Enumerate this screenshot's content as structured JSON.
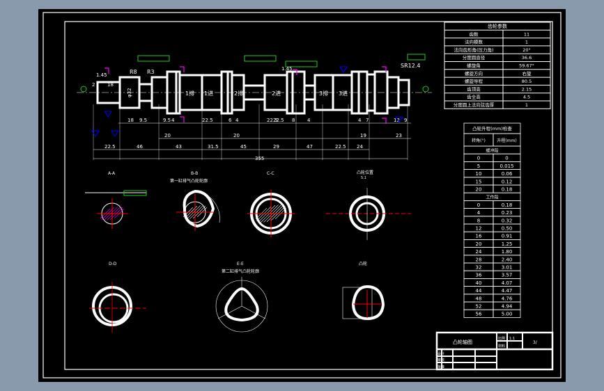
{
  "colors": {
    "background": "#8a9aad",
    "canvas": "#000000",
    "line": "#ffffff",
    "centerline": "#ff0000",
    "tolerance": "#22cc22",
    "section_mark": "#ff00ff",
    "roughness": "#0000ff"
  },
  "shaft": {
    "labels": {
      "r8": "R8",
      "r3": "R3",
      "chamfer1": "1.45",
      "chamfer2": "1.45",
      "dia": "φ32",
      "d18": "18",
      "d2": "2",
      "sr": "SR12.4"
    },
    "cams": [
      "1排",
      "1进",
      "2排",
      "2进",
      "3排",
      "3进"
    ],
    "dims_row1": [
      "18",
      "9.5",
      "9.5",
      "4",
      "22.5",
      "6",
      "4",
      "22.5",
      "8",
      "4",
      "22.5",
      "4",
      "7",
      "12",
      "9"
    ],
    "dims_row2": [
      "20",
      "20",
      "19",
      "23"
    ],
    "dims_row3": [
      "22.5",
      "46",
      "43",
      "31.5",
      "45",
      "29",
      "47",
      "22.5",
      "24"
    ],
    "total": "355"
  },
  "sections": [
    {
      "label": "A-A"
    },
    {
      "label": "B-B",
      "note": "第一缸排气凸轮轮廓"
    },
    {
      "label": "C-C"
    },
    {
      "label": "凸轮位置",
      "sub": "5.1"
    },
    {
      "label": "D-D"
    },
    {
      "label": "E-E",
      "note": "第二缸排气凸轮轮廓"
    },
    {
      "label": "凸轮"
    }
  ],
  "param_table": {
    "title": "齿轮参数",
    "rows": [
      [
        "齿数",
        "11"
      ],
      [
        "法向模数",
        "1"
      ],
      [
        "法向齿形角(压力角)",
        "20°"
      ],
      [
        "分度圆直径",
        "36.6"
      ],
      [
        "螺旋角",
        "59.67°"
      ],
      [
        "螺旋方向",
        "右旋"
      ],
      [
        "螺旋导程",
        "80.5"
      ],
      [
        "齿顶高",
        "2.15"
      ],
      [
        "齿全高",
        "4.5"
      ],
      [
        "分度圆上法向弦齿厚",
        "1"
      ]
    ]
  },
  "lift_table": {
    "title": "凸轮升程(mm)检查",
    "headers": [
      "转角(°)",
      "升程(mm)"
    ],
    "groups": [
      {
        "name": "缓冲段",
        "rows": [
          [
            "0",
            "0"
          ],
          [
            "5",
            "0.015"
          ],
          [
            "10",
            "0.06"
          ],
          [
            "15",
            "0.12"
          ],
          [
            "20",
            "0.18"
          ]
        ]
      },
      {
        "name": "工作段",
        "rows": [
          [
            "0",
            "0.18"
          ],
          [
            "4",
            "0.23"
          ],
          [
            "8",
            "0.32"
          ],
          [
            "12",
            "0.50"
          ],
          [
            "16",
            "0.91"
          ],
          [
            "20",
            "1.25"
          ],
          [
            "24",
            "1.80"
          ],
          [
            "28",
            "2.40"
          ],
          [
            "32",
            "3.01"
          ],
          [
            "36",
            "3.57"
          ],
          [
            "40",
            "4.07"
          ],
          [
            "44",
            "4.47"
          ],
          [
            "48",
            "4.76"
          ],
          [
            "52",
            "4.94"
          ],
          [
            "56",
            "5.00"
          ]
        ]
      }
    ]
  },
  "title_block": {
    "name": "凸轮轴图",
    "scale_label": "比例",
    "scale": "1:1",
    "material_label": "材料",
    "sheet": "3/",
    "drawn": "设计",
    "checked": "审核",
    "approved": "批准"
  }
}
